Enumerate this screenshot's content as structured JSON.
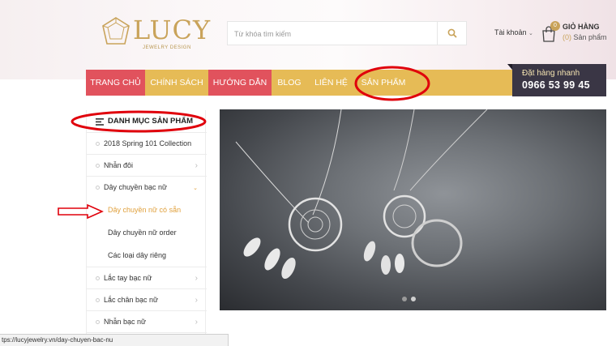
{
  "header": {
    "logo": {
      "brand": "LUCY",
      "tagline": "JEWELRY DESIGN"
    },
    "search": {
      "placeholder": "Từ khóa tìm kiếm"
    },
    "account_label": "Tài khoản",
    "cart": {
      "count": "0",
      "title": "GIỎ HÀNG",
      "count_paren": "(0)",
      "subtitle": "Sản phẩm"
    }
  },
  "nav": {
    "items": [
      {
        "label": "TRANG CHỦ"
      },
      {
        "label": "CHÍNH SÁCH"
      },
      {
        "label": "HƯỚNG DẪN"
      },
      {
        "label": "BLOG"
      },
      {
        "label": "LIÊN HỆ"
      },
      {
        "label": "SẢN PHẨM"
      }
    ],
    "hotline": {
      "label": "Đặt hàng nhanh",
      "phone": "0966 53 99 45"
    }
  },
  "sidebar": {
    "title": "DANH MỤC SẢN PHẨM",
    "items": [
      {
        "label": "2018 Spring 101 Collection"
      },
      {
        "label": "Nhẫn đôi"
      },
      {
        "label": "Dây chuyền bạc nữ"
      },
      {
        "label": "Dây chuyền nữ có sẵn"
      },
      {
        "label": "Dây chuyền nữ order"
      },
      {
        "label": "Các loại dây riêng"
      },
      {
        "label": "Lắc tay bạc nữ"
      },
      {
        "label": "Lắc chân bạc nữ"
      },
      {
        "label": "Nhẫn bạc nữ"
      }
    ]
  },
  "slider": {
    "slides": 2,
    "active_index": 1
  },
  "statusbar": {
    "url": "tps://lucyjewelry.vn/day-chuyen-bac-nu"
  },
  "colors": {
    "gold": "#e6bb56",
    "red": "#e1525d",
    "dark": "#3a3645",
    "accent_text": "#e0a03c",
    "annotation": "#e0000b"
  },
  "icons": [
    "logo-diamond-icon",
    "search-icon",
    "chevron-down-icon",
    "shopping-bag-icon",
    "list-icon",
    "chevron-right-icon",
    "arrow-right-icon"
  ]
}
